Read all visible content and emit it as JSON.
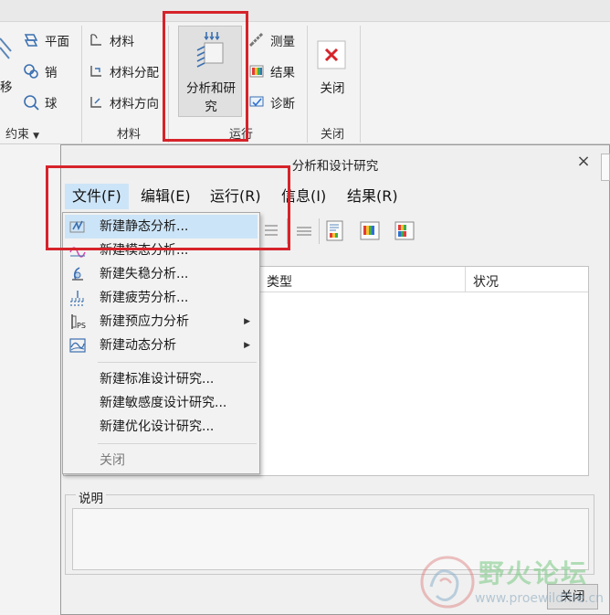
{
  "ribbon": {
    "constraint_group": {
      "partial_left_label": "移",
      "items": [
        {
          "label": "平面",
          "icon": "plane-icon"
        },
        {
          "label": "销",
          "icon": "pin-icon"
        },
        {
          "label": "球",
          "icon": "ball-icon"
        }
      ],
      "group_label": "约束",
      "group_dropdown_icon": "caret-down-icon"
    },
    "material_group": {
      "items": [
        {
          "label": "材料",
          "icon": "material-icon"
        },
        {
          "label": "材料分配",
          "icon": "material-assign-icon"
        },
        {
          "label": "材料方向",
          "icon": "material-orient-icon"
        }
      ],
      "group_label": "材料"
    },
    "run_group": {
      "big_button_label_line1": "分析和研",
      "big_button_label_line2": "究",
      "items": [
        {
          "label": "测量",
          "icon": "measure-icon"
        },
        {
          "label": "结果",
          "icon": "results-icon"
        },
        {
          "label": "诊断",
          "icon": "diagnose-icon"
        }
      ],
      "group_label": "运行"
    },
    "close_group": {
      "button_label": "关闭",
      "group_label": "关闭"
    }
  },
  "dialog": {
    "title": "分析和设计研究",
    "close_glyph": "×",
    "menus": [
      "文件(F)",
      "编辑(E)",
      "运行(R)",
      "信息(I)",
      "结果(R)"
    ],
    "table_headers": [
      "类型",
      "状况"
    ],
    "description_label": "说明",
    "close_button": "关闭"
  },
  "file_menu": {
    "items": [
      {
        "label": "新建静态分析...",
        "icon": "static-analysis-icon",
        "highlighted": true
      },
      {
        "label": "新建模态分析...",
        "icon": "modal-analysis-icon"
      },
      {
        "label": "新建失稳分析...",
        "icon": "buckling-analysis-icon"
      },
      {
        "label": "新建疲劳分析...",
        "icon": "fatigue-analysis-icon"
      },
      {
        "label": "新建预应力分析",
        "icon": "prestress-analysis-icon",
        "submenu": true
      },
      {
        "label": "新建动态分析",
        "icon": "dynamic-analysis-icon",
        "submenu": true
      },
      {
        "label": "新建标准设计研究..."
      },
      {
        "label": "新建敏感度设计研究..."
      },
      {
        "label": "新建优化设计研究..."
      },
      {
        "label": "关闭",
        "disabled": true
      }
    ],
    "submenu_arrow": "▶"
  },
  "watermark": {
    "title": "野火论坛",
    "url": "www.proewildfire.cn"
  },
  "colors": {
    "highlight_red": "#d6232a",
    "menu_active_bg": "#cce4f7",
    "close_icon_red": "#d6232a"
  }
}
